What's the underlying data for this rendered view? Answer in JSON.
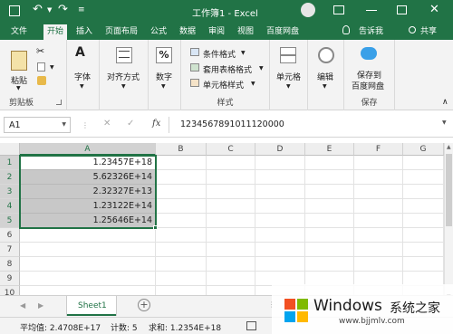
{
  "title_bar": {
    "title": "工作簿1 - Excel",
    "undo_icon": "undo-icon",
    "redo_icon": "redo-icon"
  },
  "tabs": [
    "文件",
    "开始",
    "插入",
    "页面布局",
    "公式",
    "数据",
    "审阅",
    "视图",
    "百度网盘"
  ],
  "tell_me": "告诉我",
  "share": "共享",
  "ribbon": {
    "paste": "粘贴",
    "clipboard": "剪贴板",
    "font": "字体",
    "alignment": "对齐方式",
    "number": "数字",
    "cond_format": "条件格式",
    "table_format": "套用表格格式",
    "cell_style": "单元格样式",
    "styles": "样式",
    "cells": "单元格",
    "editing": "编辑",
    "save_to_line1": "保存到",
    "save_to_line2": "百度网盘",
    "save": "保存",
    "percent_symbol": "%"
  },
  "formula_bar": {
    "name_box": "A1",
    "cancel": "✕",
    "confirm": "✓",
    "fx": "fx",
    "content": "1234567891011120000"
  },
  "columns": [
    "A",
    "B",
    "C",
    "D",
    "E",
    "F",
    "G"
  ],
  "rows": [
    "1",
    "2",
    "3",
    "4",
    "5",
    "6",
    "7",
    "8",
    "9",
    "10",
    "11",
    "12"
  ],
  "cells_A": [
    "1.23457E+18",
    "5.62326E+14",
    "2.32327E+13",
    "1.23122E+14",
    "1.25646E+14"
  ],
  "sheet": {
    "tab": "Sheet1",
    "add": "+"
  },
  "status": {
    "average": "平均值: 2.4708E+17",
    "count": "计数: 5",
    "sum": "求和: 1.2354E+18"
  },
  "watermark": {
    "brand": "Windows",
    "cn": "系统之家",
    "url": "www.bjjmlv.com"
  },
  "colors": {
    "excel_green": "#217346",
    "selection_gray": "#c8c8c8"
  }
}
